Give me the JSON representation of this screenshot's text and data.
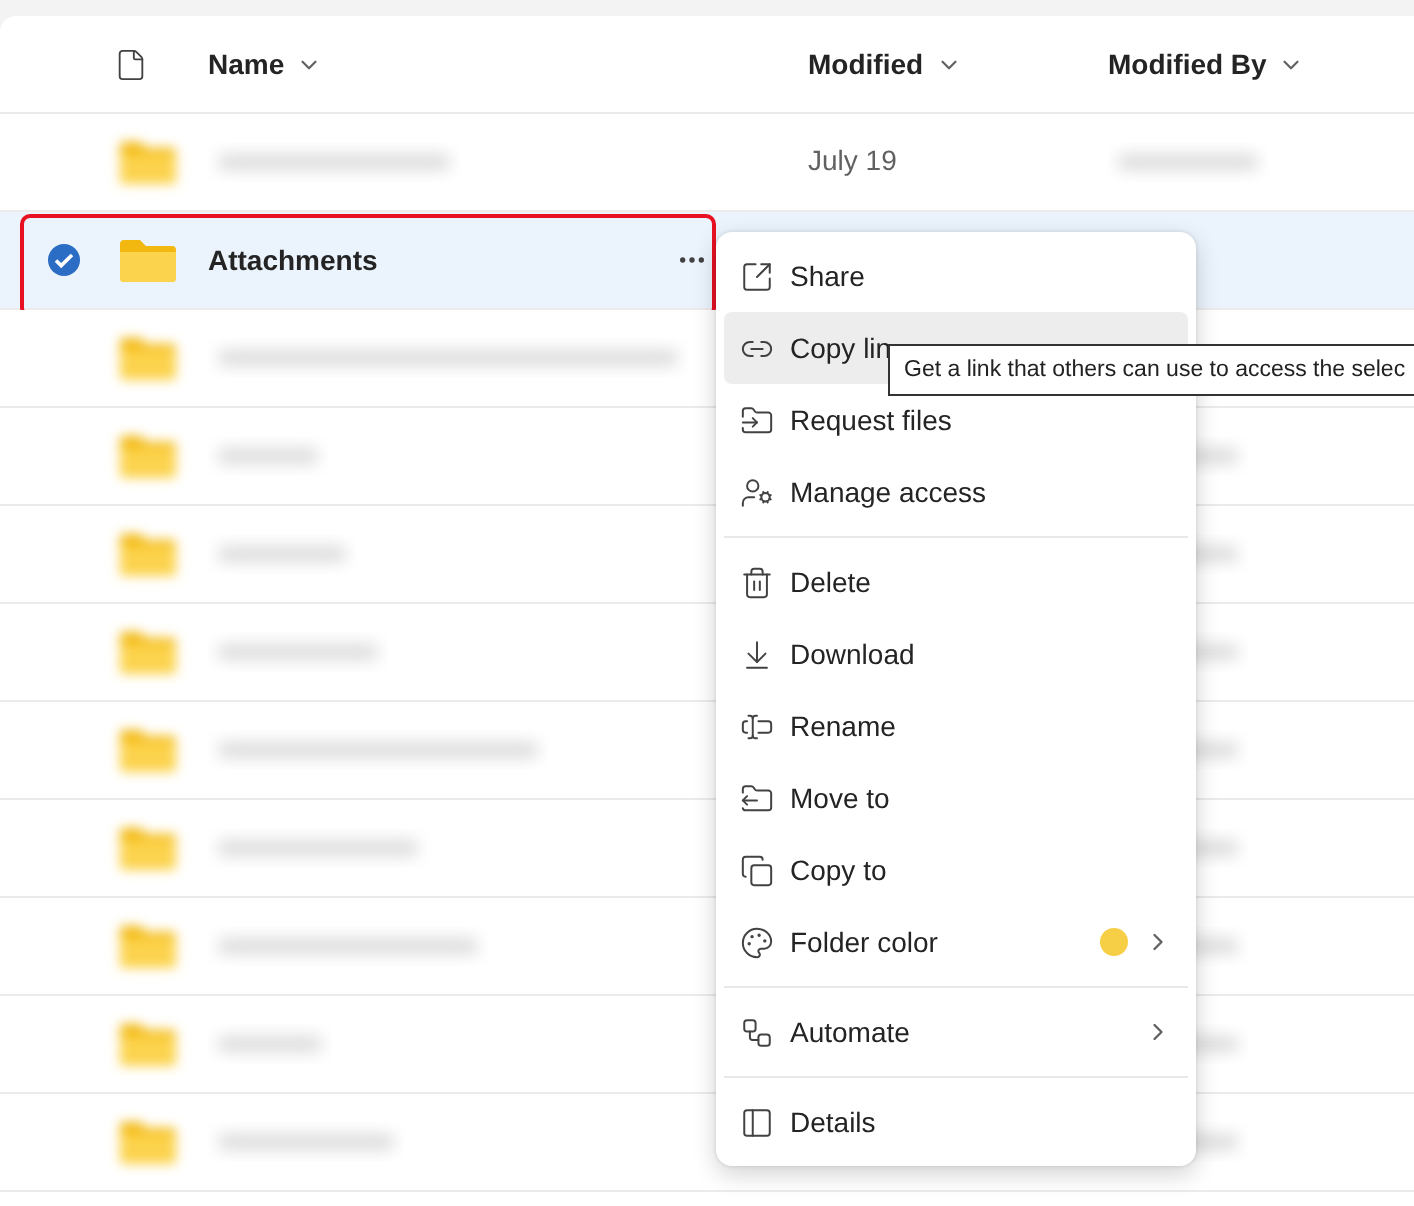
{
  "table": {
    "columns": [
      {
        "label": "Name",
        "sortable": true
      },
      {
        "label": "Modified",
        "sortable": true
      },
      {
        "label": "Modified By",
        "sortable": true
      }
    ],
    "rows": [
      {
        "kind": "blurred",
        "selected": false,
        "outlined": false,
        "modified": "July 19"
      },
      {
        "kind": "folder",
        "selected": true,
        "outlined": true,
        "name": "Attachments"
      },
      {
        "kind": "blurred",
        "selected": false,
        "outlined": false
      },
      {
        "kind": "blurred",
        "selected": false,
        "outlined": false
      },
      {
        "kind": "blurred",
        "selected": false,
        "outlined": false
      },
      {
        "kind": "blurred",
        "selected": false,
        "outlined": false
      },
      {
        "kind": "blurred",
        "selected": false,
        "outlined": false
      },
      {
        "kind": "blurred",
        "selected": false,
        "outlined": false
      },
      {
        "kind": "blurred",
        "selected": false,
        "outlined": false
      },
      {
        "kind": "blurred",
        "selected": false,
        "outlined": false
      },
      {
        "kind": "blurred",
        "selected": false,
        "outlined": false
      }
    ]
  },
  "context_menu": {
    "groups": [
      [
        {
          "label": "Share",
          "hovered": false
        },
        {
          "label": "Copy lin",
          "hovered": true
        },
        {
          "label": "Request files",
          "hovered": false
        },
        {
          "label": "Manage access",
          "hovered": false
        }
      ],
      [
        {
          "label": "Delete",
          "hovered": false
        },
        {
          "label": "Download",
          "hovered": false
        },
        {
          "label": "Rename",
          "hovered": false
        },
        {
          "label": "Move to",
          "hovered": false
        },
        {
          "label": "Copy to",
          "hovered": false
        },
        {
          "label": "Folder color",
          "hovered": false,
          "color": "#f7cf46",
          "submenu": true
        }
      ],
      [
        {
          "label": "Automate",
          "hovered": false,
          "submenu": true
        }
      ],
      [
        {
          "label": "Details",
          "hovered": false
        }
      ]
    ]
  },
  "tooltip": {
    "text": "Get a link that others can use to access the selec"
  }
}
